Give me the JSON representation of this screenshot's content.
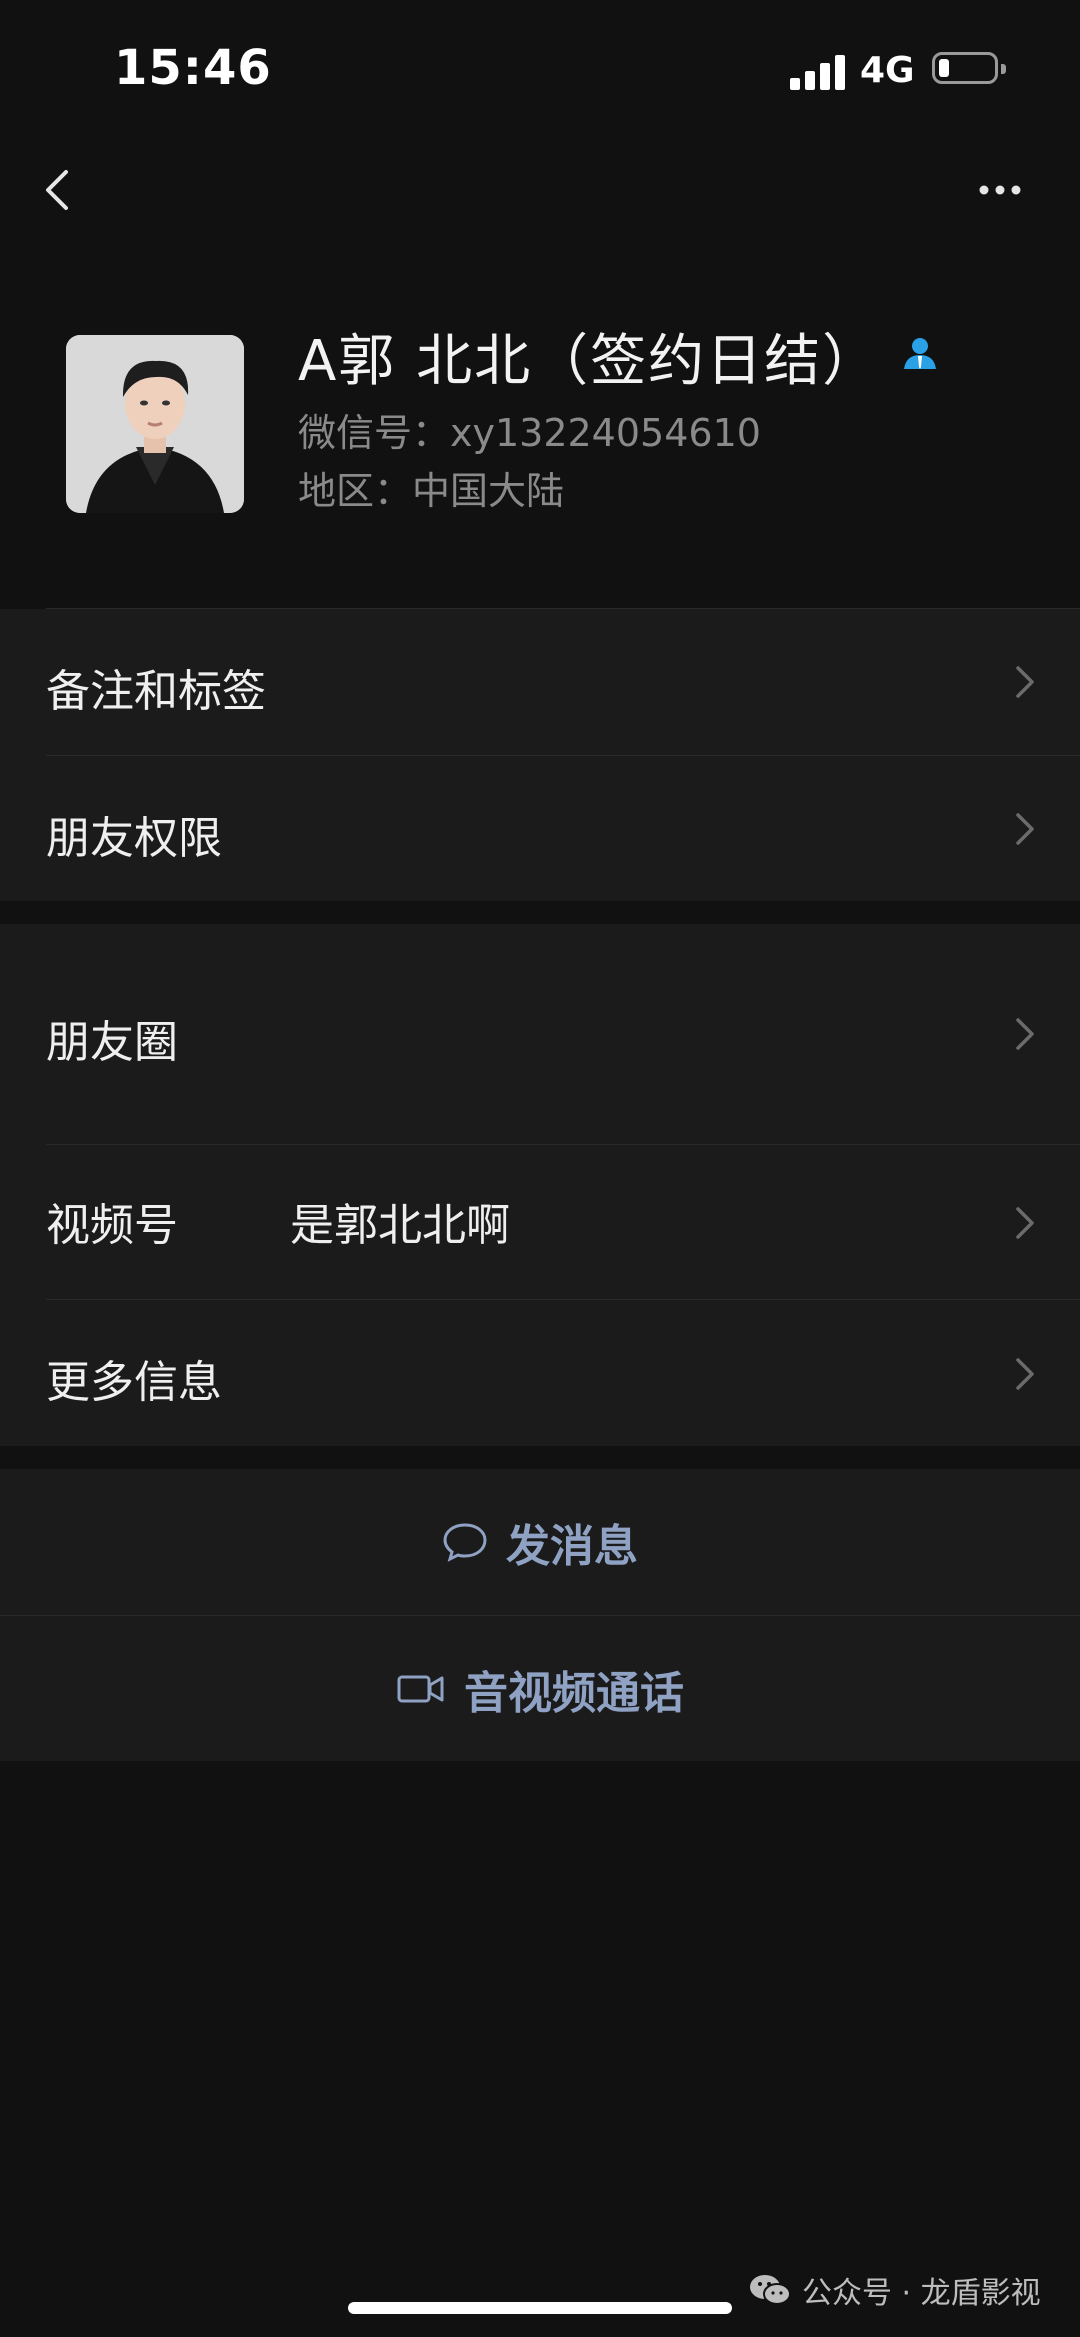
{
  "status_bar": {
    "time": "15:46",
    "network": "4G",
    "battery_level": 0.2
  },
  "profile": {
    "name": "A郭  北北（签约日结）",
    "wechat_id": "微信号：xy13224054610",
    "region": "地区：中国大陆"
  },
  "menu": {
    "notes_tags": "备注和标签",
    "friend_permissions": "朋友权限",
    "moments": "朋友圈",
    "channels_label": "视频号",
    "channels_value": "是郭北北啊",
    "more_info": "更多信息"
  },
  "actions": {
    "send_message": "发消息",
    "av_call": "音视频通话"
  },
  "watermark": "公众号 · 龙盾影视",
  "colors": {
    "accent": "#8fa2c4",
    "background": "#111111",
    "panel": "#1b1b1b"
  }
}
